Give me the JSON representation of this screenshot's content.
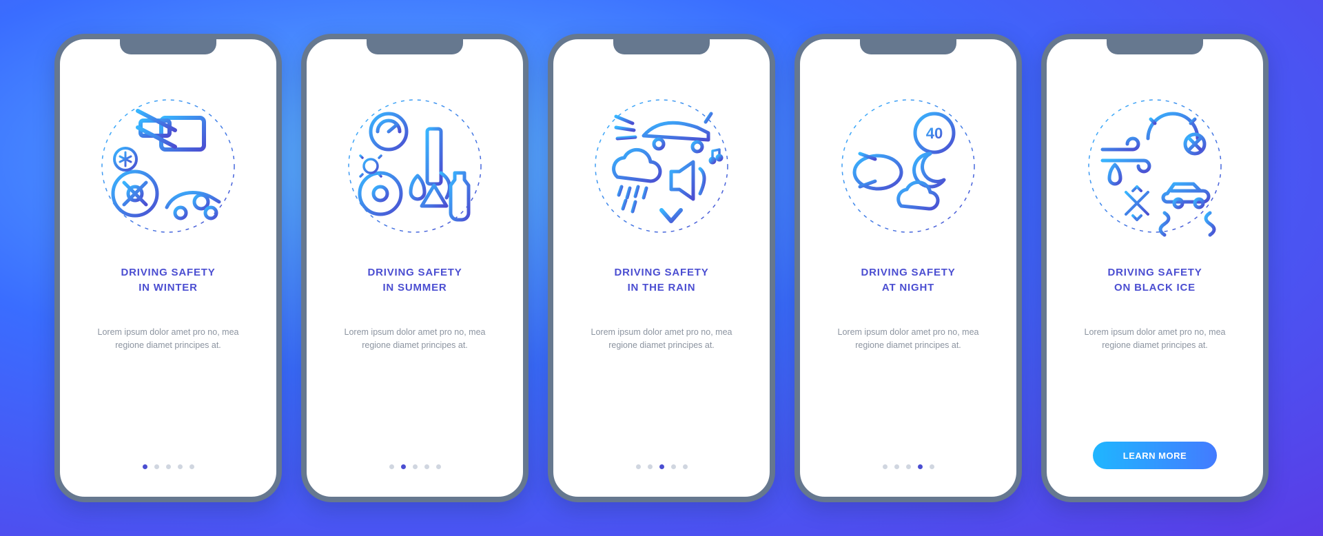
{
  "body_text": "Lorem ipsum dolor amet pro no, mea regione diamet principes at.",
  "cta_label": "LEARN MORE",
  "grad_from": "#38b6ff",
  "grad_to": "#4b4ed1",
  "screens": [
    {
      "title": "DRIVING SAFETY\nIN WINTER",
      "icon": "winter-driving-icon",
      "active_index": 0
    },
    {
      "title": "DRIVING SAFETY\nIN SUMMER",
      "icon": "summer-driving-icon",
      "active_index": 1
    },
    {
      "title": "DRIVING SAFETY\nIN THE RAIN",
      "icon": "rain-driving-icon",
      "active_index": 2
    },
    {
      "title": "DRIVING SAFETY\nAT NIGHT",
      "icon": "night-driving-icon",
      "active_index": 3
    },
    {
      "title": "DRIVING SAFETY\nON BLACK ICE",
      "icon": "blackice-driving-icon",
      "active_index": 4
    }
  ]
}
